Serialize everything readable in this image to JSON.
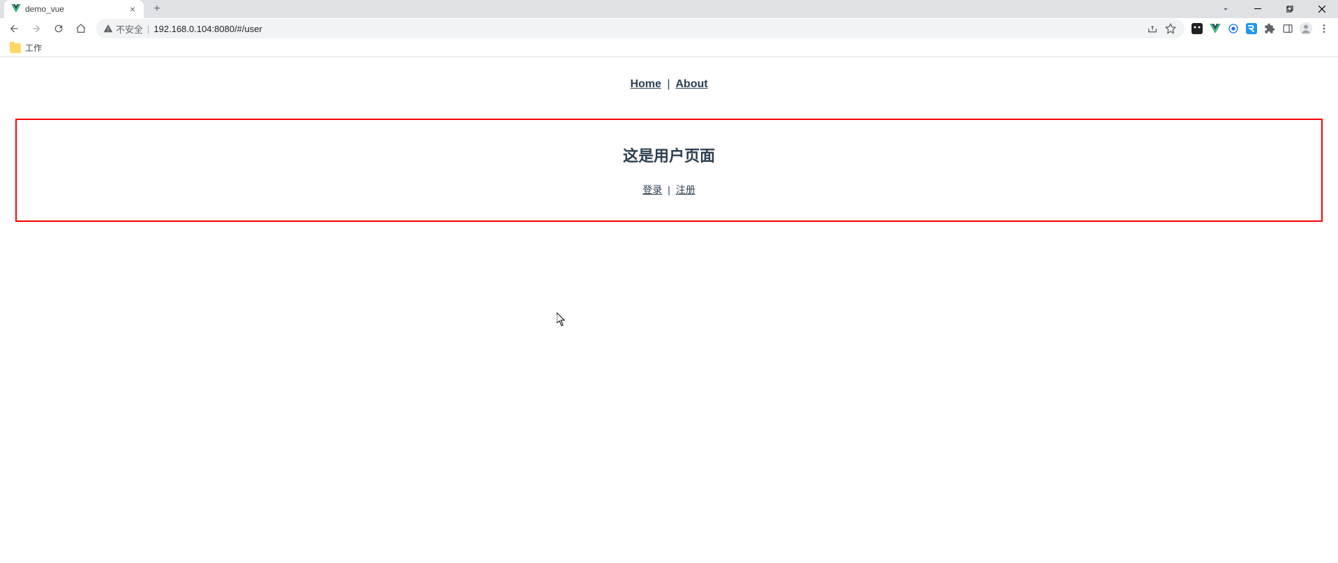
{
  "browser": {
    "tab": {
      "title": "demo_vue"
    },
    "security_label": "不安全",
    "url": "192.168.0.104:8080/#/user",
    "bookmarks": [
      {
        "label": "工作"
      }
    ]
  },
  "page": {
    "topnav": {
      "home": "Home",
      "about": "About"
    },
    "heading": "这是用户页面",
    "links": {
      "login": "登录",
      "register": "注册"
    }
  }
}
